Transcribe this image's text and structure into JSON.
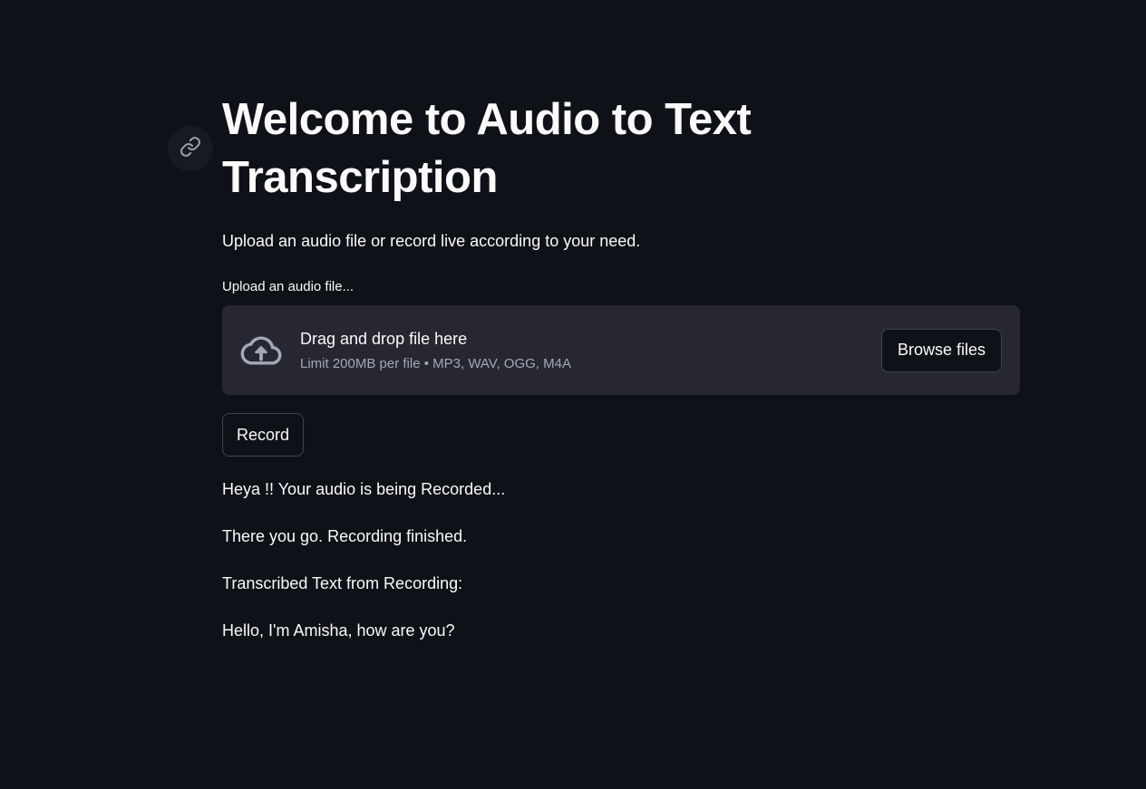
{
  "header": {
    "title": "Welcome to Audio to Text Transcription",
    "subtitle": "Upload an audio file or record live according to your need."
  },
  "uploader": {
    "label": "Upload an audio file...",
    "drop_text": "Drag and drop file here",
    "limit_text": "Limit 200MB per file • MP3, WAV, OGG, M4A",
    "browse_label": "Browse files"
  },
  "record": {
    "button_label": "Record"
  },
  "messages": {
    "recording": "Heya !! Your audio is being Recorded...",
    "finished": "There you go. Recording finished.",
    "transcribed_heading": "Transcribed Text from Recording:",
    "transcribed_text": "Hello, I'm Amisha, how are you?"
  },
  "icons": {
    "anchor": "link-icon",
    "upload": "cloud-upload-icon"
  },
  "colors": {
    "background": "#0e1117",
    "dropzone": "#262730",
    "text": "#fafafa",
    "muted_text": "#a3a8b8"
  }
}
